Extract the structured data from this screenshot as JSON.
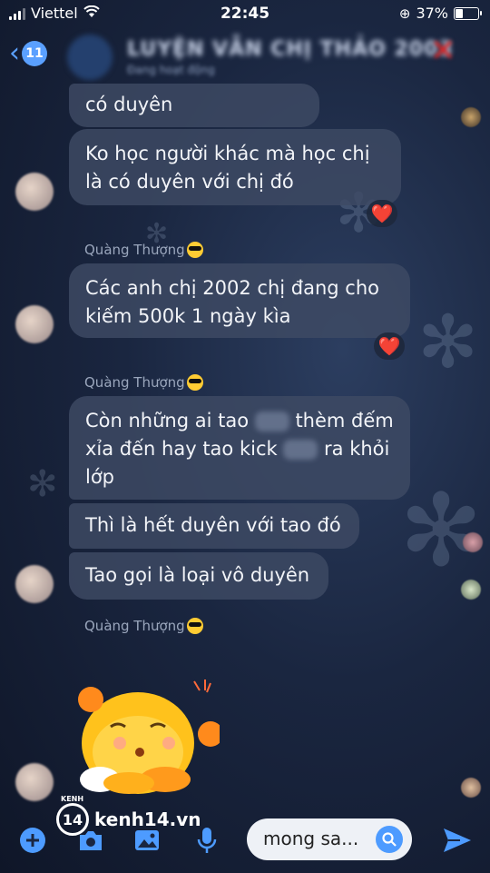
{
  "status_bar": {
    "carrier": "Viettel",
    "time": "22:45",
    "battery": "37%",
    "battery_level": 0.37
  },
  "header": {
    "unread_count": "11",
    "title": "LUYỆN VẪN CHỊ THẢO 2003",
    "subtitle": "Đang hoạt động"
  },
  "messages": [
    {
      "text": "có duyên"
    },
    {
      "text": "Ko học người khác mà học chị là có duyên với chị đó",
      "reaction": "❤️"
    },
    {
      "sender": "Quàng Thượng",
      "text": "Các anh chị 2002 chị đang cho kiếm 500k 1 ngày kìa",
      "reaction": "❤️"
    },
    {
      "sender": "Quàng Thượng",
      "line1a": "Còn những ai tao",
      "line1b": "thèm đếm",
      "line2a": "xỉa đến hay tao kick",
      "line2b": "ra khỏi",
      "line3": "lớp"
    },
    {
      "text": "Thì là hết duyên với tao đó"
    },
    {
      "text": "Tao gọi là loại vô duyên"
    },
    {
      "sender": "Quàng Thượng",
      "sticker": "cute-yellow-creature-sticker"
    }
  ],
  "watermark": {
    "kenh_label": "KENH",
    "logo_num": "14",
    "site": "kenh14.vn"
  },
  "input_bar": {
    "text": "mong sa..."
  },
  "colors": {
    "accent": "#4d9bff",
    "bubble": "#3e4a64",
    "heart": "#ff2d3d"
  }
}
